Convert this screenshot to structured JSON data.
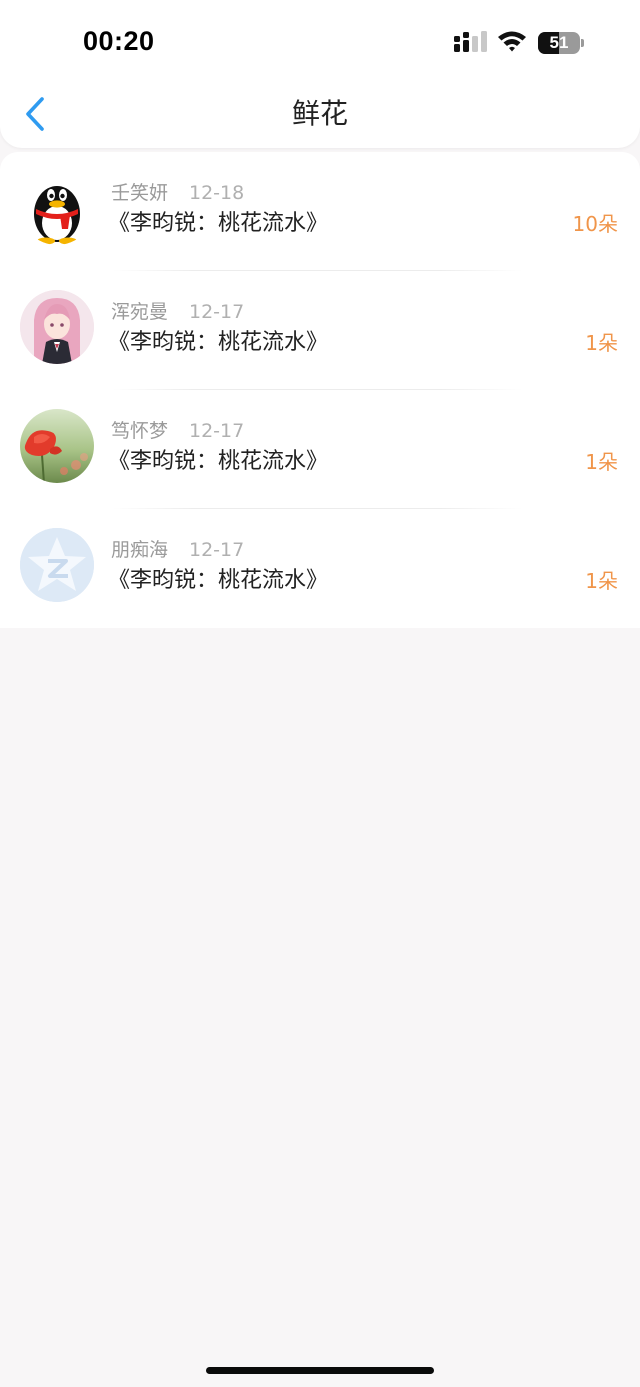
{
  "status_bar": {
    "time": "00:20",
    "battery_text": "51",
    "battery_level": 0.51
  },
  "nav": {
    "title": "鲜花",
    "back_icon": "chevron-left-icon",
    "accent_color": "#2f9bf0"
  },
  "list": {
    "count_color": "#f0954a",
    "items": [
      {
        "sender": "壬笑妍",
        "date": "12-18",
        "title": "《李昀锐：桃花流水》",
        "count": "10朵",
        "avatar": "penguin-avatar"
      },
      {
        "sender": "浑宛曼",
        "date": "12-17",
        "title": "《李昀锐：桃花流水》",
        "count": "1朵",
        "avatar": "anime-girl-avatar"
      },
      {
        "sender": "笃怀梦",
        "date": "12-17",
        "title": "《李昀锐：桃花流水》",
        "count": "1朵",
        "avatar": "poppy-flower-avatar"
      },
      {
        "sender": "朋痴海",
        "date": "12-17",
        "title": "《李昀锐：桃花流水》",
        "count": "1朵",
        "avatar": "qzone-star-avatar"
      }
    ]
  }
}
